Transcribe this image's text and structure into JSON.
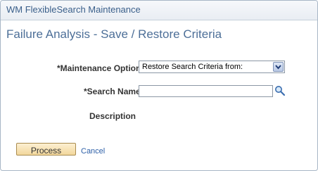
{
  "window": {
    "title": "WM FlexibleSearch Maintenance"
  },
  "page": {
    "title": "Failure Analysis - Save / Restore Criteria"
  },
  "form": {
    "maintenance_option": {
      "label": "*Maintenance Option",
      "selected": "Restore Search Criteria from:"
    },
    "search_name": {
      "label": "*Search Name",
      "value": ""
    },
    "description": {
      "label": "Description"
    }
  },
  "actions": {
    "process_label": "Process",
    "cancel_label": "Cancel"
  },
  "icons": {
    "lookup": "magnifier-icon",
    "dropdown": "chevron-down-icon"
  },
  "colors": {
    "title_text": "#4d6f98",
    "link": "#2b5ea7",
    "button_fill": "#f2d79c"
  }
}
